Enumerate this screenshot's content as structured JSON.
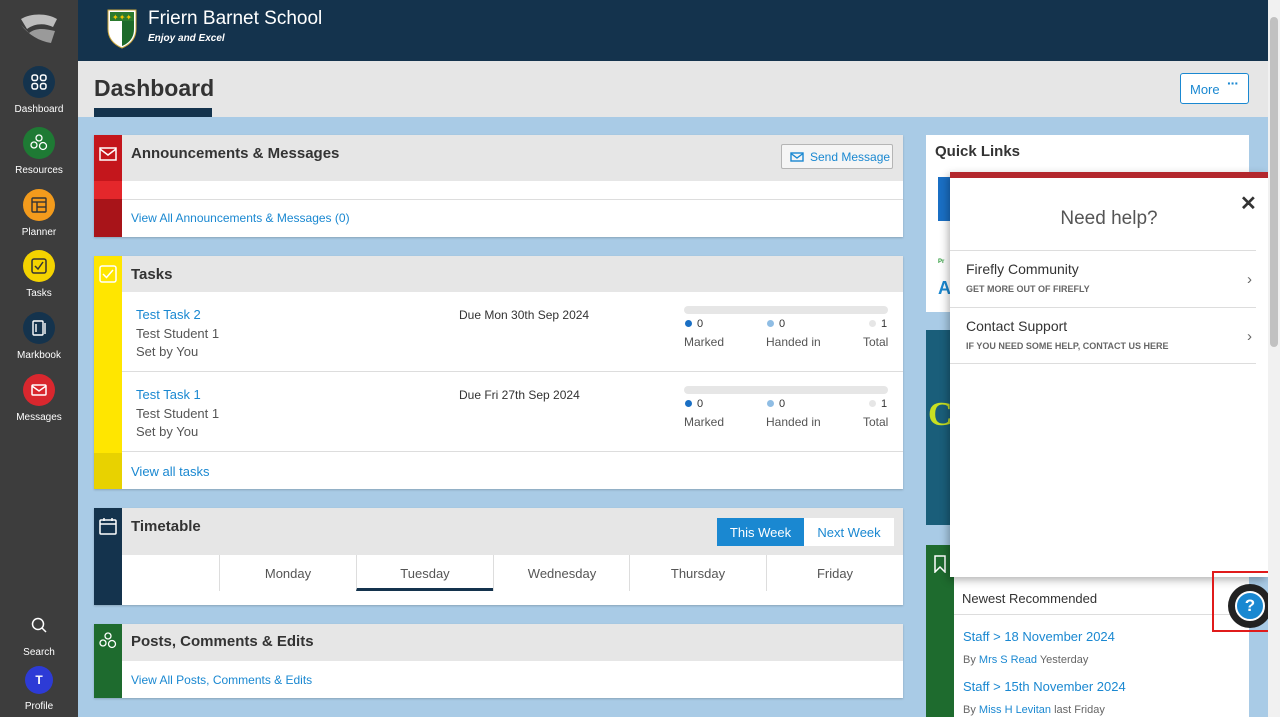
{
  "school": {
    "name": "Friern Barnet School",
    "motto": "Enjoy and Excel"
  },
  "sidebar": {
    "items": [
      {
        "label": "Dashboard",
        "color": "#14334d"
      },
      {
        "label": "Resources",
        "color": "#1e7a34"
      },
      {
        "label": "Planner",
        "color": "#f39b1c"
      },
      {
        "label": "Tasks",
        "color": "#f4d300"
      },
      {
        "label": "Markbook",
        "color": "#14334d"
      },
      {
        "label": "Messages",
        "color": "#d9272e"
      }
    ],
    "search_label": "Search",
    "profile_label": "Profile",
    "profile_initial": "T"
  },
  "page": {
    "title": "Dashboard",
    "more_label": "More"
  },
  "announcements": {
    "title": "Announcements & Messages",
    "send_label": "Send Message",
    "view_all": "View All Announcements & Messages (0)"
  },
  "tasks": {
    "title": "Tasks",
    "view_all": "View all tasks",
    "items": [
      {
        "name": "Test Task 2",
        "student": "Test Student 1",
        "set_by": "Set by You",
        "due": "Due Mon 30th Sep 2024",
        "marked": "0",
        "handed_in": "0",
        "total": "1"
      },
      {
        "name": "Test Task 1",
        "student": "Test Student 1",
        "set_by": "Set by You",
        "due": "Due Fri 27th Sep 2024",
        "marked": "0",
        "handed_in": "0",
        "total": "1"
      }
    ],
    "labels": {
      "marked": "Marked",
      "handed_in": "Handed in",
      "total": "Total"
    }
  },
  "timetable": {
    "title": "Timetable",
    "this_week": "This Week",
    "next_week": "Next Week",
    "days": [
      "Monday",
      "Tuesday",
      "Wednesday",
      "Thursday",
      "Friday"
    ],
    "selected_day": "Tuesday"
  },
  "posts": {
    "title": "Posts, Comments & Edits",
    "view_all": "View All Posts, Comments & Edits"
  },
  "quick_links": {
    "title": "Quick Links"
  },
  "recommended": {
    "title": "Newest Recommended",
    "items": [
      {
        "title": "Staff > 18 November 2024",
        "by": "By",
        "author": "Mrs S Read",
        "when": "Yesterday"
      },
      {
        "title": "Staff > 15th November 2024",
        "by": "By",
        "author": "Miss H Levitan",
        "when": "last Friday"
      }
    ]
  },
  "help": {
    "title": "Need help?",
    "items": [
      {
        "title": "Firefly Community",
        "subtitle": "GET MORE OUT OF FIREFLY"
      },
      {
        "title": "Contact Support",
        "subtitle": "IF YOU NEED SOME HELP, CONTACT US HERE"
      }
    ]
  },
  "colors": {
    "accent": "#1a88d1",
    "navy": "#14334d",
    "red": "#d9272e",
    "yellow": "#ffe600",
    "green": "#1e6b2e"
  }
}
